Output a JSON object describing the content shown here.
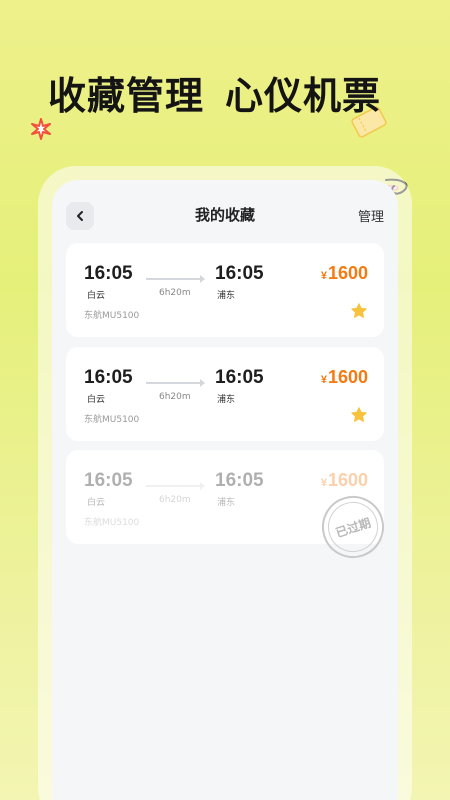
{
  "headline": {
    "left": "收藏管理",
    "right": "心仪机票"
  },
  "nav": {
    "title": "我的收藏",
    "manage_label": "管理"
  },
  "flights": [
    {
      "dep_time": "16:05",
      "arr_time": "16:05",
      "dep_city": "白云",
      "arr_city": "浦东",
      "duration": "6h20m",
      "flight_no": "东航MU5100",
      "currency": "¥",
      "price": "1600",
      "expired": false
    },
    {
      "dep_time": "16:05",
      "arr_time": "16:05",
      "dep_city": "白云",
      "arr_city": "浦东",
      "duration": "6h20m",
      "flight_no": "东航MU5100",
      "currency": "¥",
      "price": "1600",
      "expired": false
    },
    {
      "dep_time": "16:05",
      "arr_time": "16:05",
      "dep_city": "白云",
      "arr_city": "浦东",
      "duration": "6h20m",
      "flight_no": "东航MU5100",
      "currency": "¥",
      "price": "1600",
      "expired": true,
      "expired_label": "已过期"
    }
  ],
  "colors": {
    "price": "#f57a12",
    "star": "#f7c23c",
    "background_top": "#eef08a"
  },
  "icons": {
    "back": "chevron-left-icon",
    "favorite": "star-icon"
  }
}
